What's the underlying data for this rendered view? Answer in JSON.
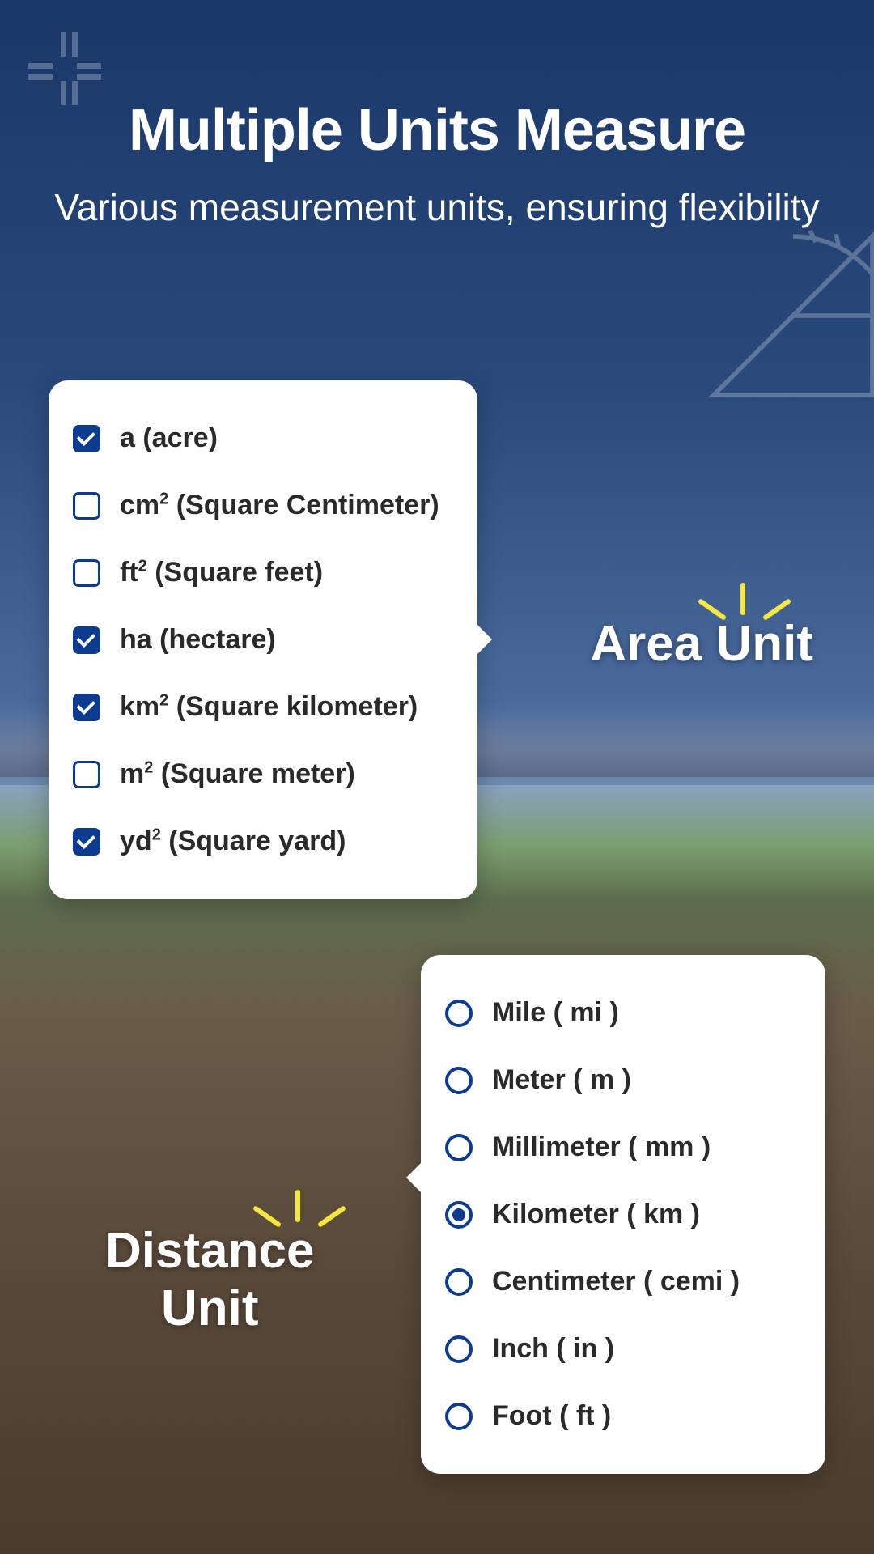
{
  "header": {
    "title": "Multiple Units Measure",
    "subtitle": "Various measurement units, ensuring flexibility"
  },
  "sections": {
    "area_label": "Area Unit",
    "distance_label_line1": "Distance",
    "distance_label_line2": "Unit"
  },
  "area_units": [
    {
      "label": "a (acre)",
      "checked": true
    },
    {
      "label": "cm²  (Square Centimeter)",
      "checked": false
    },
    {
      "label": "ft²  (Square feet)",
      "checked": false
    },
    {
      "label": "ha (hectare)",
      "checked": true
    },
    {
      "label": "km²  (Square kilometer)",
      "checked": true
    },
    {
      "label": "m² (Square meter)",
      "checked": false
    },
    {
      "label": "yd²  (Square yard)",
      "checked": true
    }
  ],
  "distance_units": [
    {
      "label": "Mile  ( mi )",
      "selected": false
    },
    {
      "label": "Meter  ( m )",
      "selected": false
    },
    {
      "label": "Millimeter ( mm )",
      "selected": false
    },
    {
      "label": "Kilometer  ( km )",
      "selected": true
    },
    {
      "label": "Centimeter ( cemi )",
      "selected": false
    },
    {
      "label": "Inch ( in )",
      "selected": false
    },
    {
      "label": "Foot  ( ft )",
      "selected": false
    }
  ]
}
